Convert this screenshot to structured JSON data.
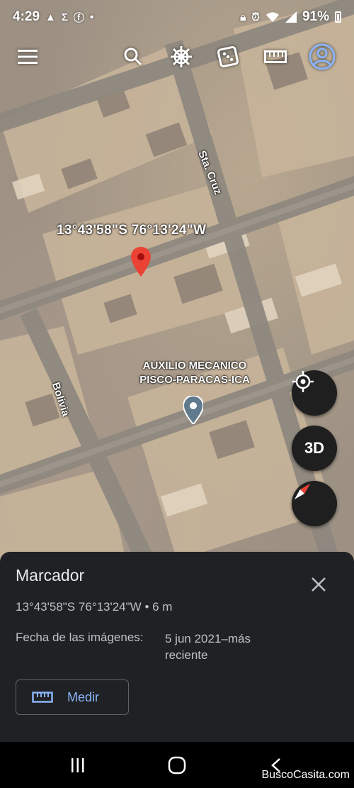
{
  "status": {
    "time": "4:29",
    "battery": "91%",
    "left_icons": [
      "warning-icon",
      "sigma-icon",
      "facebook-icon",
      "dot-icon"
    ],
    "right_icons": [
      "lock-icon",
      "alarm-icon",
      "wifi-icon",
      "signal-icon",
      "battery-icon"
    ]
  },
  "toolbar": {
    "icons": [
      "menu-icon",
      "search-icon",
      "voyager-wheel-icon",
      "dice-icon",
      "ruler-icon",
      "account-icon"
    ]
  },
  "map": {
    "coords_label": "13°43'58\"S 76°13'24\"W",
    "poi_line1": "AUXILIO MECANICO",
    "poi_line2": "PISCO-PARACAS-ICA",
    "street_a": "Sta. Cruz",
    "street_b": "Bolivia",
    "buttons": {
      "threed": "3D"
    }
  },
  "sheet": {
    "title": "Marcador",
    "coords": "13°43'58\"S 76°13'24\"W • 6 m",
    "date_label": "Fecha de las imágenes:",
    "date_value": "5 jun 2021–más reciente",
    "measure_label": "Medir"
  },
  "watermark": "BuscoCasita.com",
  "colors": {
    "accent": "#8ab4f8",
    "pin_red": "#ea4335",
    "sheet_bg": "#202124"
  }
}
